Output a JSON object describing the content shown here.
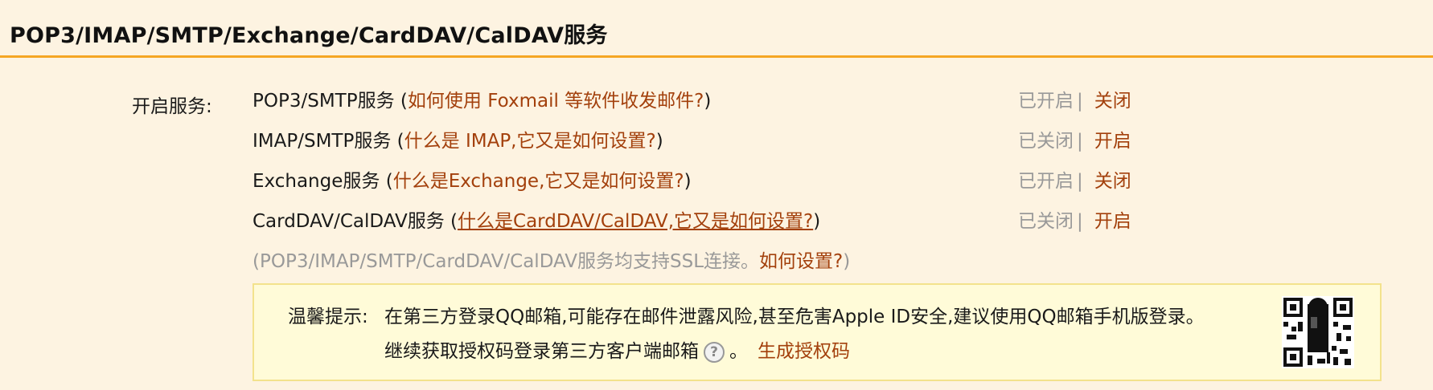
{
  "header": {
    "title": "POP3/IMAP/SMTP/Exchange/CardDAV/CalDAV服务"
  },
  "services_label": "开启服务:",
  "services": [
    {
      "name": "POP3/SMTP服务",
      "open_paren": "(",
      "help": "如何使用 Foxmail 等软件收发邮件?",
      "close_paren": ")",
      "status": "已开启",
      "separator": "|",
      "action": "关闭"
    },
    {
      "name": "IMAP/SMTP服务",
      "open_paren": "(",
      "help": "什么是 IMAP,它又是如何设置?",
      "close_paren": ")",
      "status": "已关闭",
      "separator": "|",
      "action": "开启"
    },
    {
      "name": "Exchange服务",
      "open_paren": "(",
      "help": "什么是Exchange,它又是如何设置?",
      "close_paren": ")",
      "status": "已开启",
      "separator": "|",
      "action": "关闭"
    },
    {
      "name": "CardDAV/CalDAV服务",
      "open_paren": "(",
      "help": "什么是CardDAV/CalDAV,它又是如何设置?",
      "close_paren": ")",
      "status": "已关闭",
      "separator": "|",
      "action": "开启"
    }
  ],
  "ssl_note": {
    "text": "(POP3/IMAP/SMTP/CardDAV/CalDAV服务均支持SSL连接。",
    "link": "如何设置?",
    "close": ")"
  },
  "tip": {
    "label": "温馨提示:",
    "line1": "在第三方登录QQ邮箱,可能存在邮件泄露风险,甚至危害Apple ID安全,建议使用QQ邮箱手机版登录。",
    "line2": "继续获取授权码登录第三方客户端邮箱",
    "qmark": "?",
    "period": "。",
    "generate_link": "生成授权码"
  },
  "icons": {
    "help": "help-icon",
    "qr": "qr-code-icon"
  },
  "colors": {
    "background": "#fdf3e1",
    "accent_line": "#f5a623",
    "link": "#a3400c",
    "muted": "#999999",
    "tip_bg": "#fffbd8",
    "tip_border": "#f3e28c"
  }
}
